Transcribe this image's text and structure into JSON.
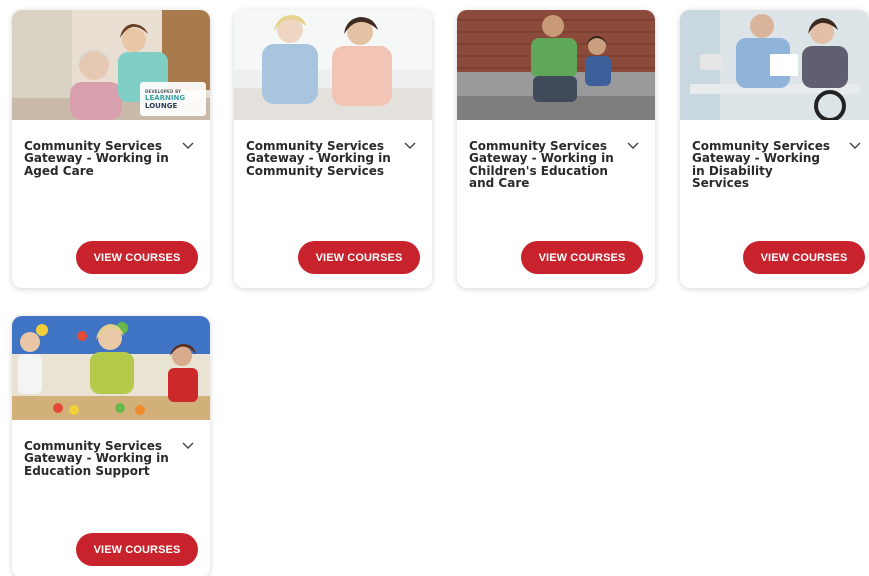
{
  "colors": {
    "button_bg": "#c8232c",
    "button_text": "#ffffff",
    "title_text": "#2a2a2a",
    "card_bg": "#ffffff"
  },
  "cards": [
    {
      "title": "Community Services Gateway - Working in Aged Care",
      "button_label": "VIEW COURSES",
      "chevron_icon": "chevron-down-icon",
      "image": "caregiver-with-elderly-woman",
      "logo": {
        "small": "DEVELOPED BY",
        "line1": "LEARNING",
        "line2": "LOUNGE"
      }
    },
    {
      "title": "Community Services Gateway - Working in Community Services",
      "button_label": "VIEW COURSES",
      "chevron_icon": "chevron-down-icon",
      "image": "two-women-counselling"
    },
    {
      "title": "Community Services Gateway - Working in Children's Education and Care",
      "button_label": "VIEW COURSES",
      "chevron_icon": "chevron-down-icon",
      "image": "man-and-child-sitting"
    },
    {
      "title": "Community Services Gateway - Working in Disability Services",
      "button_label": "VIEW COURSES",
      "chevron_icon": "chevron-down-icon",
      "image": "man-with-woman-in-wheelchair"
    },
    {
      "title": "Community Services Gateway - Working in Education Support",
      "button_label": "VIEW COURSES",
      "chevron_icon": "chevron-down-icon",
      "image": "teacher-with-children-playing"
    }
  ]
}
